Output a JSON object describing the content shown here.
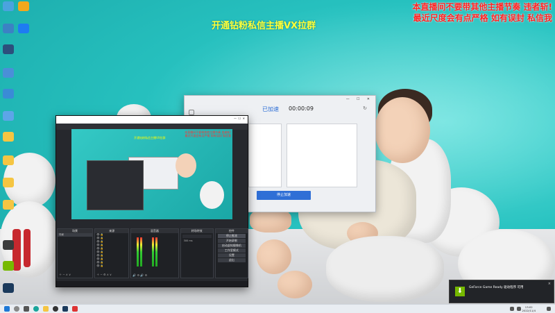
{
  "overlay": {
    "center_text": "开通钻粉私信主播VX拉群",
    "right_line1": "本直播间不要带其他主播节奏 违者斩!",
    "right_line2": "最近尺度会有点严格 如有误封 私信我"
  },
  "desktop_icons": [
    {
      "name": "recycle-bin",
      "color": "#4aa3df"
    },
    {
      "name": "app-icon-2",
      "color": "#f2a81d"
    },
    {
      "name": "this-pc",
      "color": "#3b82c4"
    },
    {
      "name": "kugou-icon",
      "color": "#1e7cf2"
    },
    {
      "name": "app-icon-5",
      "color": "#2c4f7c"
    },
    {
      "name": "app-icon-6",
      "color": "#4a8fd8"
    },
    {
      "name": "app-icon-7",
      "color": "#3a8bd6"
    },
    {
      "name": "app-icon-8",
      "color": "#5da5e8"
    },
    {
      "name": "folder-1",
      "color": "#f5c542"
    },
    {
      "name": "folder-2",
      "color": "#f5c542"
    },
    {
      "name": "folder-3",
      "color": "#f5c542"
    },
    {
      "name": "folder-4",
      "color": "#f5c542"
    },
    {
      "name": "obs-icon",
      "color": "#3b3b3b"
    },
    {
      "name": "geforce-icon",
      "color": "#76b900"
    },
    {
      "name": "steam-icon",
      "color": "#1b3a5c"
    }
  ],
  "steam": {
    "status": "已加速",
    "timer": "00:00:09",
    "stop_button": "停止加速"
  },
  "obs": {
    "preview_text": "开通钻粉私信主播VX拉群",
    "docks": {
      "scenes": "场景",
      "sources": "来源",
      "mixer": "混音器",
      "transitions": "转场特效",
      "controls": "控件"
    },
    "scene_item": "场景",
    "controls": [
      "停止推流",
      "开始录制",
      "启动虚拟摄像机",
      "工作室模式",
      "设置",
      "退出"
    ],
    "transition_duration": "300 ms"
  },
  "notification": {
    "title": "GeForce Game Ready 驱动程序 可用",
    "close": "×"
  },
  "taskbar": {
    "time": "13:02",
    "date": "2022/11/4"
  },
  "colors": {
    "accent_blue": "#2f6fd6",
    "overlay_yellow": "#ffff3a",
    "overlay_red": "#ff2222",
    "nvidia_green": "#76b900"
  }
}
